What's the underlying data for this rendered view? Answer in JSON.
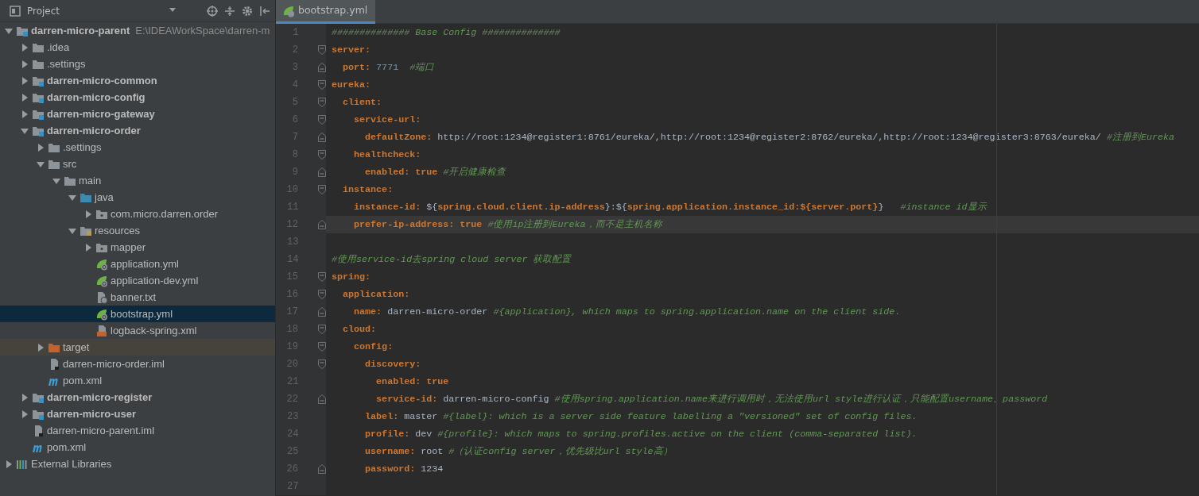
{
  "project_panel": {
    "title": "Project",
    "tree": [
      {
        "label": "darren-micro-parent",
        "hint": "E:\\IDEAWorkSpace\\darren-m",
        "kind": "module",
        "expanded": true,
        "selected": false,
        "children": [
          {
            "label": ".idea",
            "kind": "folder",
            "expanded": false,
            "selected": false
          },
          {
            "label": ".settings",
            "kind": "folder",
            "expanded": false,
            "selected": false
          },
          {
            "label": "darren-micro-common",
            "kind": "module",
            "expanded": false,
            "selected": false
          },
          {
            "label": "darren-micro-config",
            "kind": "module",
            "expanded": false,
            "selected": false
          },
          {
            "label": "darren-micro-gateway",
            "kind": "module",
            "expanded": false,
            "selected": false
          },
          {
            "label": "darren-micro-order",
            "kind": "module",
            "expanded": true,
            "selected": false,
            "children": [
              {
                "label": ".settings",
                "kind": "folder",
                "expanded": false,
                "selected": false
              },
              {
                "label": "src",
                "kind": "folder",
                "expanded": true,
                "selected": false,
                "children": [
                  {
                    "label": "main",
                    "kind": "folder",
                    "expanded": true,
                    "selected": false,
                    "children": [
                      {
                        "label": "java",
                        "kind": "source",
                        "expanded": true,
                        "selected": false,
                        "children": [
                          {
                            "label": "com.micro.darren.order",
                            "kind": "package",
                            "expanded": false,
                            "selected": false
                          }
                        ]
                      },
                      {
                        "label": "resources",
                        "kind": "resources",
                        "expanded": true,
                        "selected": false,
                        "children": [
                          {
                            "label": "mapper",
                            "kind": "package",
                            "expanded": false,
                            "selected": false
                          },
                          {
                            "label": "application.yml",
                            "kind": "spring",
                            "selected": false
                          },
                          {
                            "label": "application-dev.yml",
                            "kind": "spring",
                            "selected": false
                          },
                          {
                            "label": "banner.txt",
                            "kind": "text",
                            "selected": false
                          },
                          {
                            "label": "bootstrap.yml",
                            "kind": "spring",
                            "selected": true
                          },
                          {
                            "label": "logback-spring.xml",
                            "kind": "xml",
                            "selected": false
                          }
                        ]
                      }
                    ]
                  }
                ]
              },
              {
                "label": "target",
                "kind": "excluded",
                "expanded": false,
                "selected": false
              },
              {
                "label": "darren-micro-order.iml",
                "kind": "iml",
                "selected": false
              },
              {
                "label": "pom.xml",
                "kind": "maven",
                "selected": false
              }
            ]
          },
          {
            "label": "darren-micro-register",
            "kind": "module",
            "expanded": false,
            "selected": false
          },
          {
            "label": "darren-micro-user",
            "kind": "module",
            "expanded": false,
            "selected": false
          },
          {
            "label": "darren-micro-parent.iml",
            "kind": "iml",
            "selected": false
          },
          {
            "label": "pom.xml",
            "kind": "maven",
            "selected": false
          }
        ]
      },
      {
        "label": "External Libraries",
        "kind": "libraries",
        "expanded": false,
        "selected": false
      }
    ]
  },
  "editor": {
    "tabs": [
      {
        "label": "bootstrap.yml",
        "selected": true
      }
    ],
    "lines": [
      {
        "number": "1",
        "kind": "plain",
        "current": false,
        "tokens": [
          {
            "kind": "comment",
            "text": "############## Base Config ##############"
          }
        ]
      },
      {
        "number": "2",
        "kind": "block",
        "current": false,
        "tokens": [
          {
            "kind": "key",
            "text": "server:"
          }
        ]
      },
      {
        "number": "3",
        "kind": "block_end",
        "current": false,
        "tokens": [
          {
            "kind": "key",
            "text": "  port: "
          },
          {
            "kind": "number",
            "text": "7771"
          },
          {
            "kind": "comment",
            "text": "  #端口"
          }
        ]
      },
      {
        "number": "4",
        "kind": "block",
        "current": false,
        "tokens": [
          {
            "kind": "key",
            "text": "eureka:"
          }
        ]
      },
      {
        "number": "5",
        "kind": "block",
        "current": false,
        "tokens": [
          {
            "kind": "key",
            "text": "  client:"
          }
        ]
      },
      {
        "number": "6",
        "kind": "block",
        "current": false,
        "tokens": [
          {
            "kind": "key",
            "text": "    service-url:"
          }
        ]
      },
      {
        "number": "7",
        "kind": "block_end",
        "current": false,
        "tokens": [
          {
            "kind": "key",
            "text": "      defaultZone:"
          },
          {
            "kind": "text",
            "text": " http://root:1234@register1:8761/eureka/,http://root:1234@register2:8762/eureka/,http://root:1234@register3:8763/eureka/ "
          },
          {
            "kind": "comment",
            "text": "#注册到Eureka"
          }
        ]
      },
      {
        "number": "8",
        "kind": "block",
        "current": false,
        "tokens": [
          {
            "kind": "key",
            "text": "    healthcheck:"
          }
        ]
      },
      {
        "number": "9",
        "kind": "block_end",
        "current": false,
        "tokens": [
          {
            "kind": "key",
            "text": "      enabled: true "
          },
          {
            "kind": "comment",
            "text": "#开启健康检查"
          }
        ]
      },
      {
        "number": "10",
        "kind": "block",
        "current": false,
        "tokens": [
          {
            "kind": "key",
            "text": "  instance:"
          }
        ]
      },
      {
        "number": "11",
        "kind": "plain",
        "current": false,
        "tokens": [
          {
            "kind": "key",
            "text": "    instance-id:"
          },
          {
            "kind": "text",
            "text": " ${"
          },
          {
            "kind": "key",
            "text": "spring.cloud.client.ip-address"
          },
          {
            "kind": "text",
            "text": "}:${"
          },
          {
            "kind": "key",
            "text": "spring.application.instance_id:${server.port}"
          },
          {
            "kind": "text",
            "text": "}   "
          },
          {
            "kind": "comment",
            "text": "#instance id显示"
          }
        ]
      },
      {
        "number": "12",
        "kind": "block_end",
        "current": true,
        "tokens": [
          {
            "kind": "key",
            "text": "    prefer-ip-address: true "
          },
          {
            "kind": "comment",
            "text": "#使用ip注册到Eureka，而不是主机名称"
          }
        ]
      },
      {
        "number": "13",
        "kind": "plain",
        "current": false
      },
      {
        "number": "14",
        "kind": "plain",
        "current": false,
        "tokens": [
          {
            "kind": "comment",
            "text": "#使用service-id去spring cloud server 获取配置"
          }
        ]
      },
      {
        "number": "15",
        "kind": "block",
        "current": false,
        "tokens": [
          {
            "kind": "key",
            "text": "spring:"
          }
        ]
      },
      {
        "number": "16",
        "kind": "block",
        "current": false,
        "tokens": [
          {
            "kind": "key",
            "text": "  application:"
          }
        ]
      },
      {
        "number": "17",
        "kind": "block_end",
        "current": false,
        "tokens": [
          {
            "kind": "key",
            "text": "    name:"
          },
          {
            "kind": "text",
            "text": " darren-micro-order "
          },
          {
            "kind": "comment",
            "text": "#{application}, which maps to spring.application.name on the client side."
          }
        ]
      },
      {
        "number": "18",
        "kind": "block",
        "current": false,
        "tokens": [
          {
            "kind": "key",
            "text": "  cloud:"
          }
        ]
      },
      {
        "number": "19",
        "kind": "block",
        "current": false,
        "tokens": [
          {
            "kind": "key",
            "text": "    config:"
          }
        ]
      },
      {
        "number": "20",
        "kind": "block",
        "current": false,
        "tokens": [
          {
            "kind": "key",
            "text": "      discovery:"
          }
        ]
      },
      {
        "number": "21",
        "kind": "plain",
        "current": false,
        "tokens": [
          {
            "kind": "key",
            "text": "        enabled: true"
          }
        ]
      },
      {
        "number": "22",
        "kind": "block_end",
        "current": false,
        "tokens": [
          {
            "kind": "key",
            "text": "        service-id:"
          },
          {
            "kind": "text",
            "text": " darren-micro-config "
          },
          {
            "kind": "comment",
            "text": "#使用spring.application.name来进行调用时，无法使用url style进行认证，只能配置username、password"
          }
        ]
      },
      {
        "number": "23",
        "kind": "plain",
        "current": false,
        "tokens": [
          {
            "kind": "key",
            "text": "      label:"
          },
          {
            "kind": "text",
            "text": " master "
          },
          {
            "kind": "comment",
            "text": "#{label}: which is a server side feature labelling a \"versioned\" set of config files."
          }
        ]
      },
      {
        "number": "24",
        "kind": "plain",
        "current": false,
        "tokens": [
          {
            "kind": "key",
            "text": "      profile:"
          },
          {
            "kind": "text",
            "text": " dev "
          },
          {
            "kind": "comment",
            "text": "#{profile}: which maps to spring.profiles.active on the client (comma-separated list)."
          }
        ]
      },
      {
        "number": "25",
        "kind": "plain",
        "current": false,
        "tokens": [
          {
            "kind": "key",
            "text": "      username:"
          },
          {
            "kind": "text",
            "text": " root "
          },
          {
            "kind": "comment",
            "text": "#（认证config server，优先级比url style高）"
          }
        ]
      },
      {
        "number": "26",
        "kind": "block_end",
        "current": false,
        "tokens": [
          {
            "kind": "key",
            "text": "      password:"
          },
          {
            "kind": "text",
            "text": " 1234"
          }
        ]
      },
      {
        "number": "27",
        "kind": "plain",
        "current": false
      }
    ]
  }
}
